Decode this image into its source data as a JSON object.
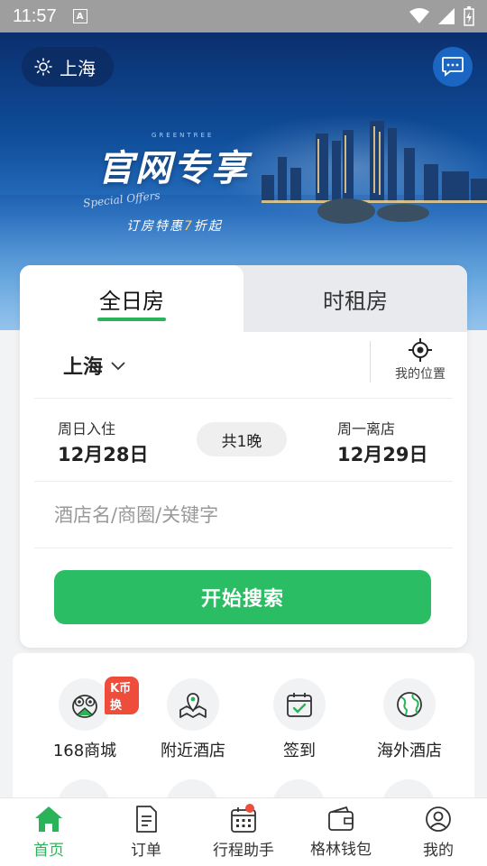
{
  "status": {
    "time": "11:57",
    "notif": "A"
  },
  "header": {
    "location": "上海",
    "icons": {
      "weather": "sun-icon",
      "message": "chat-icon"
    }
  },
  "banner": {
    "brand_small": "GREENTREE",
    "title": "官网专享",
    "en_script": "Special Offers",
    "subtitle_pre": "订房特惠",
    "subtitle_num": "7",
    "subtitle_post": "折起"
  },
  "booking": {
    "tabs": [
      {
        "label": "全日房",
        "active": true
      },
      {
        "label": "时租房",
        "active": false
      }
    ],
    "city": "上海",
    "my_location": "我的位置",
    "checkin_label": "周日入住",
    "checkin_date": "12月28日",
    "nights": "共1晚",
    "checkout_label": "周一离店",
    "checkout_date": "12月29日",
    "keyword_placeholder": "酒店名/商圈/关键字",
    "search_button": "开始搜索"
  },
  "features": [
    {
      "label": "168商城",
      "badge": "K币换",
      "icon": "owl-icon"
    },
    {
      "label": "附近酒店",
      "icon": "map-pin-icon"
    },
    {
      "label": "签到",
      "icon": "calendar-check-icon"
    },
    {
      "label": "海外酒店",
      "icon": "globe-icon"
    }
  ],
  "tabbar": [
    {
      "label": "首页",
      "icon": "home-icon",
      "active": true
    },
    {
      "label": "订单",
      "icon": "document-icon"
    },
    {
      "label": "行程助手",
      "icon": "calendar-icon",
      "dot": true
    },
    {
      "label": "格林钱包",
      "icon": "wallet-icon"
    },
    {
      "label": "我的",
      "icon": "user-icon"
    }
  ],
  "colors": {
    "accent": "#2bbd63",
    "badge": "#ee4d3c",
    "banner": "#0f4d9a"
  }
}
